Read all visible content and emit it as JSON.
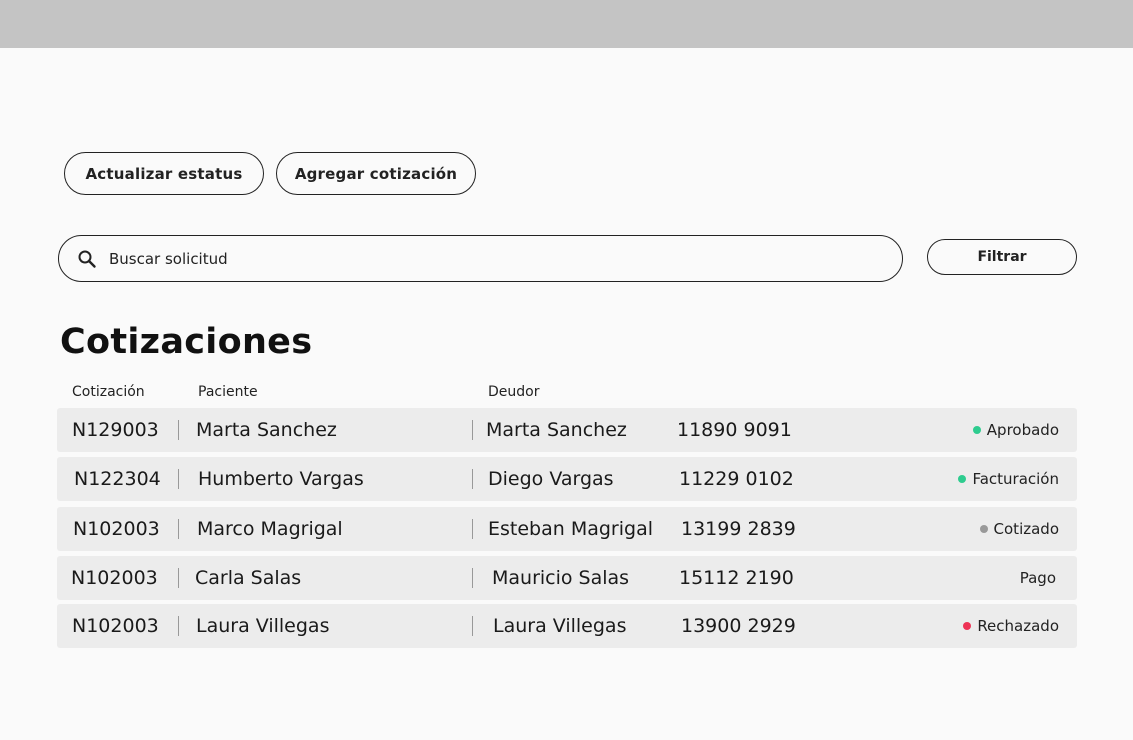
{
  "toolbar": {
    "update_status_label": "Actualizar estatus",
    "add_quote_label": "Agregar cotización"
  },
  "search": {
    "value": "Buscar solicitud",
    "icon": "search-icon"
  },
  "filter": {
    "label": "Filtrar"
  },
  "page": {
    "title": "Cotizaciones"
  },
  "table": {
    "columns": [
      "Cotización",
      "Paciente",
      "Deudor"
    ],
    "rows": [
      {
        "id": "N129003",
        "patient": "Marta Sanchez",
        "debtor": "Marta Sanchez",
        "phone": "11890 9091",
        "status": "Aprobado",
        "status_color": "#2ecc8f"
      },
      {
        "id": "N122304",
        "patient": "Humberto Vargas",
        "debtor": "Diego Vargas",
        "phone": "11229 0102",
        "status": "Facturación",
        "status_color": "#2ecc8f"
      },
      {
        "id": "N102003",
        "patient": "Marco Magrigal",
        "debtor": "Esteban Magrigal",
        "phone": "13199 2839",
        "status": "Cotizado",
        "status_color": "#999999"
      },
      {
        "id": "N102003",
        "patient": "Carla Salas",
        "debtor": "Mauricio Salas",
        "phone": "15112 2190",
        "status": "Pago",
        "status_color": ""
      },
      {
        "id": "N102003",
        "patient": "Laura Villegas",
        "debtor": "Laura Villegas",
        "phone": "13900 2929",
        "status": "Rechazado",
        "status_color": "#ee3355"
      }
    ]
  }
}
